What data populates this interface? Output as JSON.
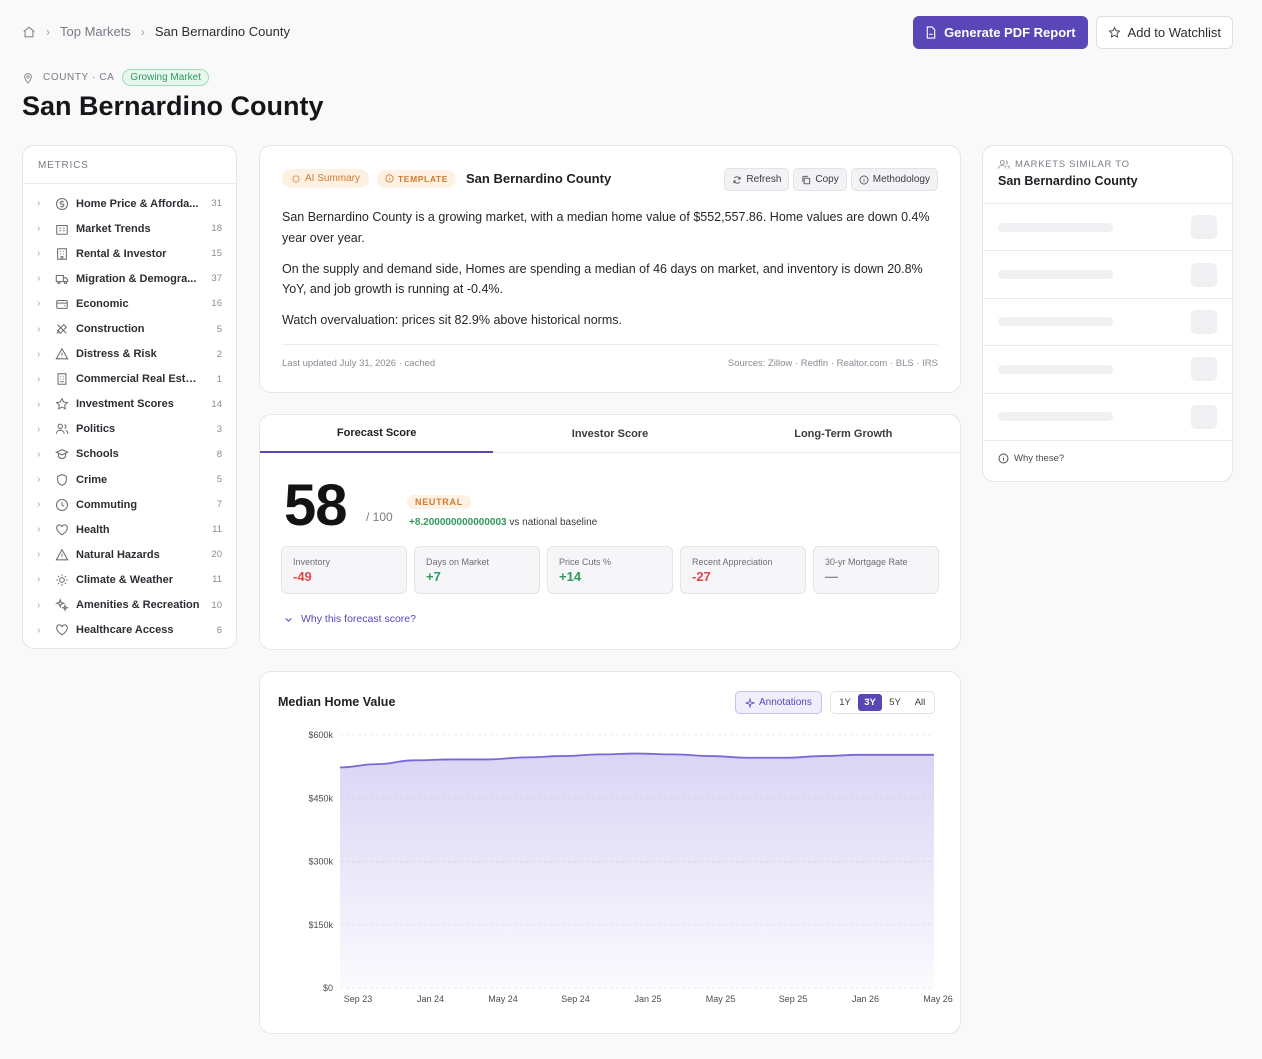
{
  "breadcrumb": {
    "items": [
      "Top Markets",
      "San Bernardino County"
    ]
  },
  "header": {
    "pdf_label": "Generate PDF Report",
    "watchlist_label": "Add to Watchlist",
    "meta": "COUNTY · CA",
    "status_badge": "Growing Market",
    "title": "San Bernardino County"
  },
  "metrics": {
    "heading": "METRICS",
    "items": [
      {
        "label": "Home Price & Afforda...",
        "count": "31",
        "icon": "dollar-icon"
      },
      {
        "label": "Market Trends",
        "count": "18",
        "icon": "building-icon"
      },
      {
        "label": "Rental & Investor",
        "count": "15",
        "icon": "apartment-icon"
      },
      {
        "label": "Migration & Demogra...",
        "count": "37",
        "icon": "truck-icon"
      },
      {
        "label": "Economic",
        "count": "16",
        "icon": "wallet-icon"
      },
      {
        "label": "Construction",
        "count": "5",
        "icon": "tools-icon"
      },
      {
        "label": "Distress & Risk",
        "count": "2",
        "icon": "warning-icon"
      },
      {
        "label": "Commercial Real Estate",
        "count": "1",
        "icon": "office-icon"
      },
      {
        "label": "Investment Scores",
        "count": "14",
        "icon": "star-icon"
      },
      {
        "label": "Politics",
        "count": "3",
        "icon": "people-icon"
      },
      {
        "label": "Schools",
        "count": "8",
        "icon": "school-icon"
      },
      {
        "label": "Crime",
        "count": "5",
        "icon": "shield-icon"
      },
      {
        "label": "Commuting",
        "count": "7",
        "icon": "clock-icon"
      },
      {
        "label": "Health",
        "count": "11",
        "icon": "heart-icon"
      },
      {
        "label": "Natural Hazards",
        "count": "20",
        "icon": "hazard-icon"
      },
      {
        "label": "Climate & Weather",
        "count": "11",
        "icon": "sun-icon"
      },
      {
        "label": "Amenities & Recreation",
        "count": "10",
        "icon": "sparkle-icon"
      },
      {
        "label": "Healthcare Access",
        "count": "6",
        "icon": "heart-outline-icon"
      }
    ]
  },
  "summary": {
    "ai_label": "AI Summary",
    "template_label": "TEMPLATE",
    "title": "San Bernardino County",
    "refresh_label": "Refresh",
    "copy_label": "Copy",
    "methodology_label": "Methodology",
    "paragraphs": [
      "San Bernardino County is a growing market, with a median home value of $552,557.86. Home values are down 0.4% year over year.",
      "On the supply and demand side, Homes are spending a median of 46 days on market, and inventory is down 20.8% YoY, and job growth is running at -0.4%.",
      "Watch overvaluation: prices sit 82.9% above historical norms."
    ],
    "updated": "Last updated July 31, 2026 · cached",
    "sources": "Sources: Zillow · Redfin · Realtor.com · BLS · IRS"
  },
  "forecast": {
    "tabs": [
      "Forecast Score",
      "Investor Score",
      "Long-Term Growth"
    ],
    "score": "58",
    "out_of": "/ 100",
    "rating": "NEUTRAL",
    "delta": "+8.200000000000003",
    "delta_suffix": "vs national baseline",
    "factors": [
      {
        "label": "Inventory",
        "value": "-49",
        "tone": "neg"
      },
      {
        "label": "Days on Market",
        "value": "+7",
        "tone": "pos"
      },
      {
        "label": "Price Cuts %",
        "value": "+14",
        "tone": "pos"
      },
      {
        "label": "Recent Appreciation",
        "value": "-27",
        "tone": "neg"
      },
      {
        "label": "30-yr Mortgage Rate",
        "value": "—",
        "tone": "muted"
      }
    ],
    "why_label": "Why this forecast score?"
  },
  "chart": {
    "annotations_label": "Annotations",
    "ranges": [
      "1Y",
      "3Y",
      "5Y",
      "All"
    ],
    "active_range": "3Y"
  },
  "chart_data": {
    "type": "area",
    "title": "Median Home Value",
    "ylim": [
      0,
      600000
    ],
    "y_ticks": [
      0,
      150000,
      300000,
      450000,
      600000
    ],
    "y_tick_labels": [
      "$0",
      "$150k",
      "$300k",
      "$450k",
      "$600k"
    ],
    "x_tick_labels": [
      "Sep 23",
      "Jan 24",
      "May 24",
      "Sep 24",
      "Jan 25",
      "May 25",
      "Sep 25",
      "Jan 26",
      "May 26"
    ],
    "series": [
      {
        "values": [
          523000,
          531000,
          540000,
          542000,
          542000,
          547000,
          550000,
          554000,
          556000,
          554000,
          550000,
          546000,
          546000,
          550000,
          553000,
          553000,
          553000
        ]
      }
    ],
    "color": "#7b68d8",
    "grid": true
  },
  "similar": {
    "subtitle": "MARKETS SIMILAR TO",
    "title": "San Bernardino County",
    "placeholder_rows": 5,
    "why_label": "Why these?"
  },
  "colors": {
    "accent": "#5b46b8",
    "positive": "#2f9a5c",
    "negative": "#e0484e",
    "warning": "#d27a2c"
  }
}
